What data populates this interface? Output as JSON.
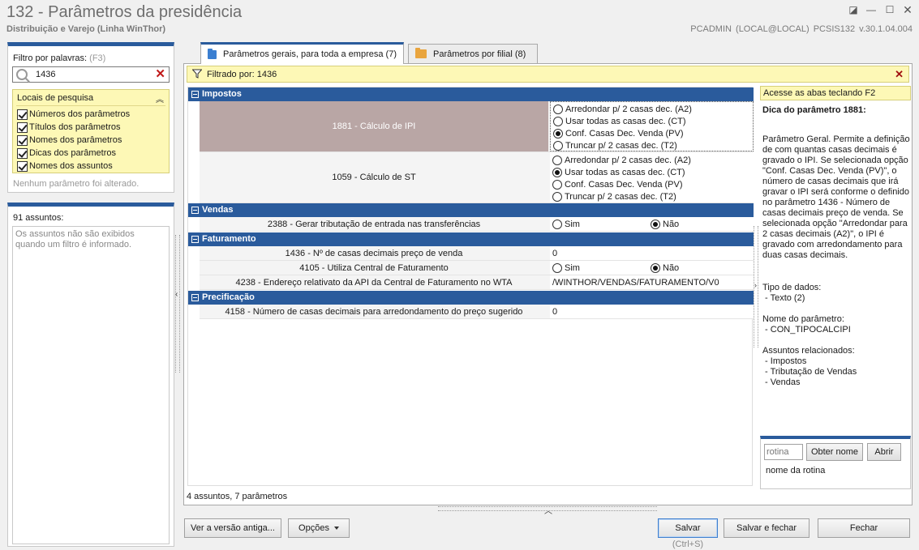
{
  "window": {
    "title": "132 - Parâmetros da presidência",
    "subtitle": "Distribuição e Varejo (Linha WinThor)",
    "user_info": "PCADMIN (LOCAL@LOCAL)  PCSIS132  v.30.1.04.004"
  },
  "sidebar": {
    "filter_label": "Filtro por palavras:",
    "filter_hint": "(F3)",
    "search_value": "1436",
    "locais_title": "Locais de pesquisa",
    "locais": [
      {
        "label": "Números dos parâmetros",
        "checked": true
      },
      {
        "label": "Títulos dos parâmetros",
        "checked": true
      },
      {
        "label": "Nomes dos parâmetros",
        "checked": true
      },
      {
        "label": "Dicas dos parâmetros",
        "checked": true
      },
      {
        "label": "Nomes dos assuntos",
        "checked": true
      }
    ],
    "status": "Nenhum parâmetro foi alterado.",
    "assuntos_count": "91 assuntos:",
    "assuntos_msg": "Os assuntos não são exibidos quando um filtro é informado."
  },
  "tabs": [
    {
      "label": "Parâmetros gerais, para toda a empresa",
      "count": "(7)",
      "active": true
    },
    {
      "label": "Parâmetros por filial",
      "count": "(8)",
      "active": false
    }
  ],
  "filter_bar": {
    "text": "Filtrado por: 1436"
  },
  "groups": [
    {
      "title": "Impostos",
      "rows": [
        {
          "name": "1881 - Cálculo de IPI",
          "selected": true,
          "type": "radio",
          "options": [
            "Arredondar p/ 2 casas dec. (A2)",
            "Usar todas as casas dec. (CT)",
            "Conf. Casas Dec. Venda (PV)",
            "Truncar p/ 2 casas dec. (T2)"
          ],
          "selected_option": 2
        },
        {
          "name": "1059 - Cálculo de ST",
          "selected": false,
          "type": "radio",
          "options": [
            "Arredondar p/ 2 casas dec. (A2)",
            "Usar todas as casas dec. (CT)",
            "Conf. Casas Dec. Venda (PV)",
            "Truncar p/ 2 casas dec. (T2)"
          ],
          "selected_option": 1
        }
      ]
    },
    {
      "title": "Vendas",
      "rows": [
        {
          "name": "2388 - Gerar tributação de entrada nas transferências",
          "type": "yesno",
          "yes": "Sim",
          "no": "Não",
          "value": "no"
        }
      ]
    },
    {
      "title": "Faturamento",
      "rows": [
        {
          "name": "1436 - Nº de casas decimais preço de venda",
          "type": "text",
          "value": "0"
        },
        {
          "name": "4105 - Utiliza Central de Faturamento",
          "type": "yesno",
          "yes": "Sim",
          "no": "Não",
          "value": "no"
        },
        {
          "name": "4238 - Endereço relativato da API da Central de Faturamento no WTA",
          "type": "text",
          "value": "/WINTHOR/VENDAS/FATURAMENTO/V0"
        }
      ]
    },
    {
      "title": "Precificação",
      "rows": [
        {
          "name": "4158 - Número de casas decimais para arredondamento do preço sugerido",
          "type": "text",
          "value": "0"
        }
      ]
    }
  ],
  "summary": "4 assuntos, 7 parâmetros",
  "help": {
    "acesse": "Acesse as abas teclando F2",
    "title": "Dica do parâmetro 1881:",
    "text": "Parâmetro Geral. Permite a definição de com quantas casas decimais é gravado o IPI. Se selecionada opção \"Conf. Casas Dec. Venda (PV)\", o número de casas decimais que irá gravar o IPI será conforme o definido no parâmetro 1436 - Número de casas decimais preço de venda. Se selecionada opção \"Arredondar para 2 casas decimais (A2)\", o IPI é gravado com arredondamento para duas casas decimais.",
    "tipo": "Tipo de dados:\n - Texto (2)",
    "nome": "Nome do parâmetro:\n - CON_TIPOCALCIPI",
    "assuntos": "Assuntos relacionados:\n - Impostos\n - Tributação de Vendas\n - Vendas",
    "rotina_placeholder": "rotina",
    "obter_nome": "Obter nome",
    "abrir": "Abrir",
    "rotina_label": "nome da rotina"
  },
  "footer": {
    "versao_antiga": "Ver a versão antiga...",
    "opcoes": "Opções",
    "salvar": "Salvar",
    "salvar_shortcut": "(Ctrl+S)",
    "salvar_fechar": "Salvar e fechar",
    "fechar": "Fechar"
  }
}
